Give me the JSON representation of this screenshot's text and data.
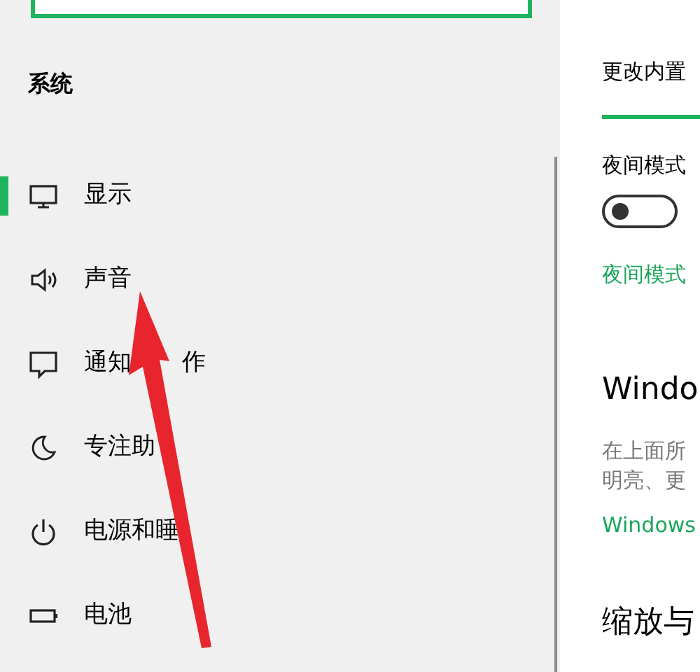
{
  "sidebar": {
    "section_title": "系统",
    "items": [
      {
        "kind": "display",
        "label": "显示",
        "selected": true
      },
      {
        "kind": "sound",
        "label": "声音",
        "selected": false
      },
      {
        "kind": "notifications",
        "label": "通知",
        "label_after": "作",
        "selected": false
      },
      {
        "kind": "focus",
        "label": "专注助",
        "selected": false
      },
      {
        "kind": "power",
        "label": "电源和睡",
        "selected": false
      },
      {
        "kind": "battery",
        "label": "电池",
        "selected": false
      }
    ]
  },
  "content": {
    "brightness_label": "更改内置",
    "brightness": {
      "level": 1
    },
    "night_light": {
      "label": "夜间模式",
      "on": false,
      "link": "夜间模式"
    },
    "windows_hd": {
      "heading": "Windo",
      "description": [
        "在上面所",
        "明亮、更"
      ],
      "link": "Windows"
    },
    "scale_heading": "缩放与"
  }
}
